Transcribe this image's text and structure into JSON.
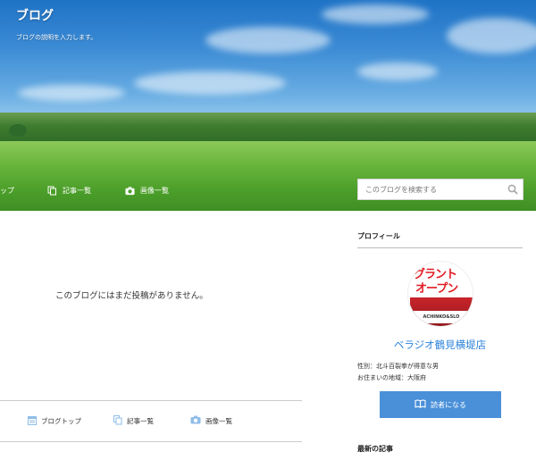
{
  "header": {
    "blog_title": "ブログ",
    "blog_description": "ブログの説明を入力します。"
  },
  "nav": {
    "items": [
      {
        "label": "トップ",
        "icon": "house-icon"
      },
      {
        "label": "記事一覧",
        "icon": "documents-icon"
      },
      {
        "label": "画像一覧",
        "icon": "camera-icon"
      }
    ]
  },
  "search": {
    "placeholder": "このブログを検索する",
    "icon": "search-icon"
  },
  "main": {
    "empty_message": "このブログにはまだ投稿がありません。"
  },
  "footer_nav": {
    "items": [
      {
        "label": "ブログトップ",
        "icon": "calendar-icon"
      },
      {
        "label": "記事一覧",
        "icon": "documents-icon"
      },
      {
        "label": "画像一覧",
        "icon": "camera-icon"
      }
    ]
  },
  "sidebar": {
    "profile_heading": "プロフィール",
    "avatar_text_1": "グラント",
    "avatar_text_2": "オープン",
    "avatar_text_3": "ACHINKO&SLO",
    "profile_name": "ベラジオ鶴見横堤店",
    "gender_line": "性別：北斗百裂拳が得意な男",
    "location_line": "お住まいの地域：大阪府",
    "follow_label": "読者になる",
    "recent_heading": "最新の記事"
  },
  "colors": {
    "accent": "#4a90d9",
    "link": "#2b82d9",
    "brand_red": "#e21b23"
  }
}
